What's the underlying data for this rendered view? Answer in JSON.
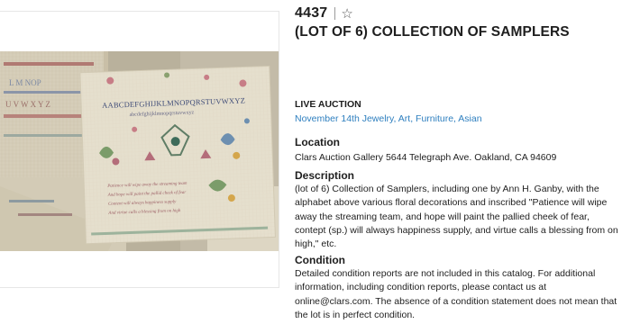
{
  "lot": {
    "number": "4437",
    "title": "(LOT OF 6) COLLECTION OF SAMPLERS"
  },
  "icons": {
    "favorite": "star-outline-icon"
  },
  "photo": {
    "sampler_alphabet": "AABCDEFGHIJKLMNOPQRSTUVWXYZ",
    "sampler_lower": "abcdefghijklmnopqrstuvwxyz",
    "sampler_verse": [
      "Patience will wipe away the streaming team",
      "And hope will paint the pallid cheek of fear",
      "Content will always happiness supply",
      "And virtue calls a blessing from on high"
    ],
    "left_sampler_text": [
      "L M NOP",
      "U V W X Y Z"
    ]
  },
  "auction": {
    "type": "LIVE AUCTION",
    "name": "November 14th Jewelry, Art, Furniture, Asian"
  },
  "location": {
    "heading": "Location",
    "text": "Clars Auction Gallery 5644 Telegraph Ave. Oakland, CA 94609"
  },
  "description": {
    "heading": "Description",
    "text": "(lot of 6) Collection of Samplers, including one by Ann H. Ganby, with the alphabet above various floral decorations and inscribed \"Patience will wipe away the streaming team, and hope will paint the pallied cheek of fear, contept (sp.) will always happiness supply, and virtue calls a blessing from on high,\" etc."
  },
  "condition": {
    "heading": "Condition",
    "text": "Detailed condition reports are not included in this catalog. For additional information, including condition reports, please contact us at online@clars.com. The absence of a condition statement does not mean that the lot is in perfect condition."
  },
  "colors": {
    "link": "#2e7fbf",
    "text": "#1e1e1e"
  }
}
